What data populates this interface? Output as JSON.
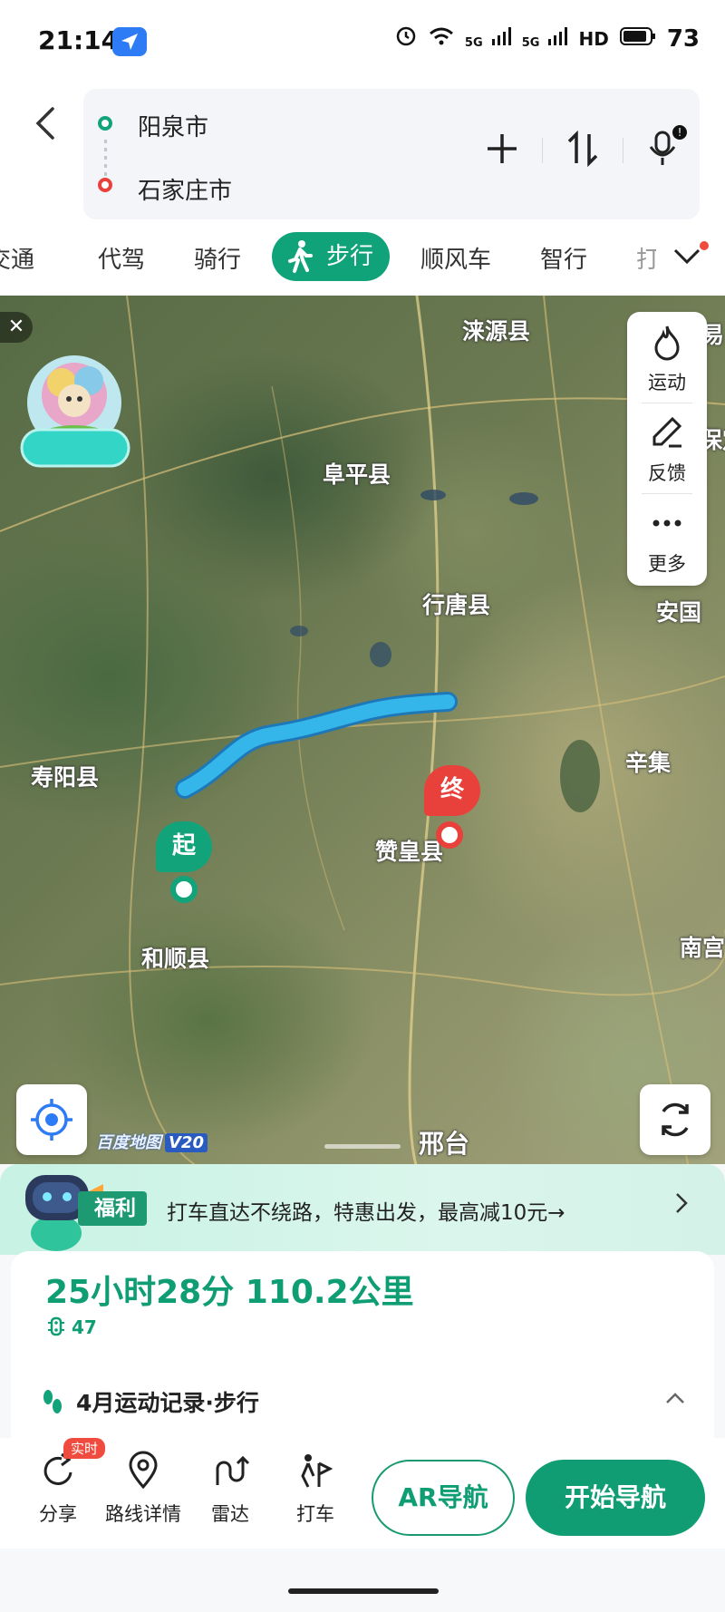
{
  "status_bar": {
    "time": "21:14",
    "network_1": "5G",
    "network_2": "5G",
    "hd": "HD",
    "battery": "73"
  },
  "route": {
    "start": "阳泉市",
    "end": "石家庄市"
  },
  "tabs": [
    {
      "label": "交通"
    },
    {
      "label": "代驾"
    },
    {
      "label": "骑行"
    },
    {
      "label": "步行",
      "active": true
    },
    {
      "label": "顺风车"
    },
    {
      "label": "智行"
    },
    {
      "label": "打"
    }
  ],
  "map": {
    "labels": [
      "涞源县",
      "易",
      "保定",
      "阜平县",
      "行唐县",
      "安国",
      "辛集",
      "寿阳县",
      "赞皇县",
      "和顺县",
      "南宫",
      "邢台"
    ],
    "start_badge": "起",
    "end_badge": "终",
    "watermark": "百度地图",
    "version": "V20",
    "close": "✕"
  },
  "side_tools": {
    "sport": "运动",
    "feedback": "反馈",
    "more": "更多"
  },
  "promo": {
    "badge": "福利",
    "text": "打车直达不绕路，特惠出发，最高减10元→"
  },
  "summary": {
    "duration_distance": "25小时28分 110.2公里",
    "lights": "47",
    "record": "4月运动记录·步行"
  },
  "actions": {
    "share": "分享",
    "live_badge": "实时",
    "route_detail": "路线详情",
    "radar": "雷达",
    "taxi": "打车",
    "ar_nav": "AR导航",
    "start_nav": "开始导航"
  },
  "colors": {
    "brand_green": "#10a37a",
    "start_marker": "#12a37a",
    "end_marker": "#e8413c",
    "route_line": "#29a6e0"
  }
}
